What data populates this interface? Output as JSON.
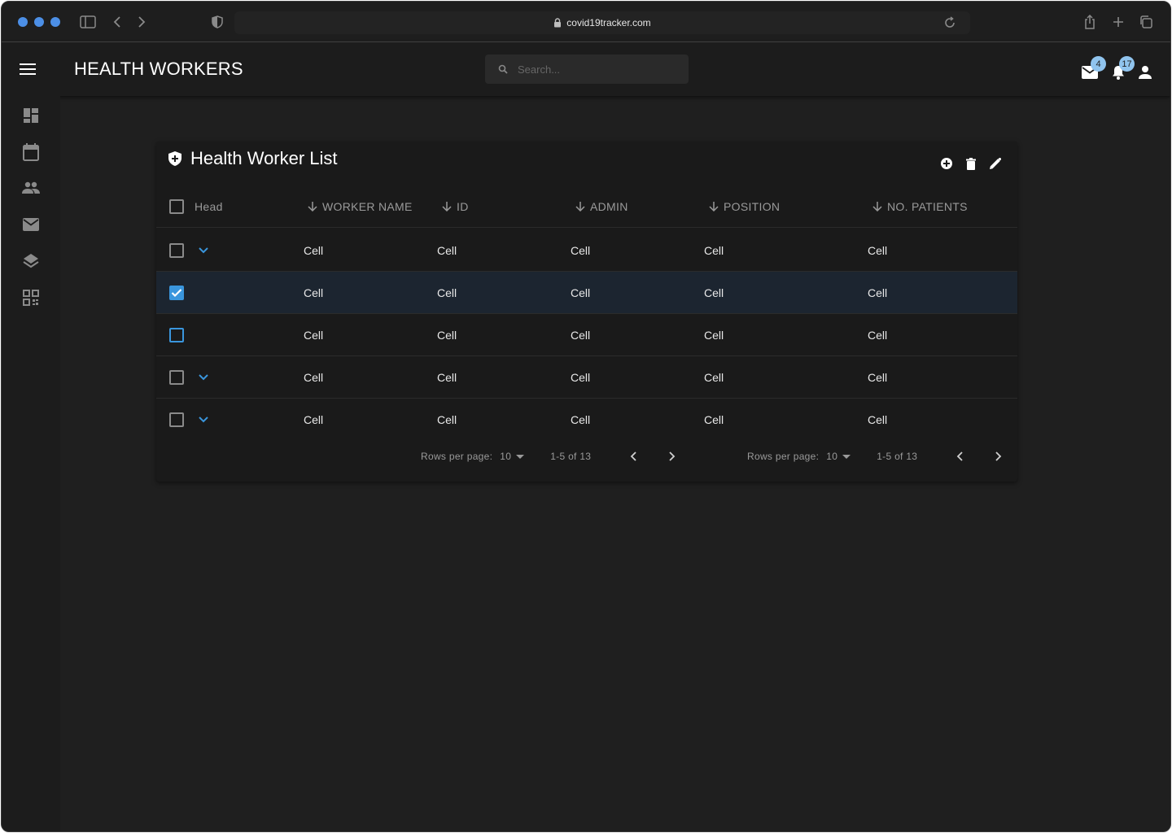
{
  "browser": {
    "url": "covid19tracker.com"
  },
  "appbar": {
    "title": "HEALTH WORKERS",
    "search_placeholder": "Search...",
    "mail_badge": "4",
    "notif_badge": "17"
  },
  "sidenav": {
    "items": [
      "dashboard-icon",
      "calendar-icon",
      "people-icon",
      "mail-icon",
      "layers-icon",
      "qr-icon"
    ]
  },
  "card": {
    "title": "Health Worker List",
    "actions": [
      "add-circle-icon",
      "delete-icon",
      "edit-icon"
    ]
  },
  "table": {
    "headers": {
      "head": "Head",
      "worker_name": "WORKER NAME",
      "id": "ID",
      "admin": "ADMIN",
      "position": "POSITION",
      "patients": "NO. PATIENTS"
    },
    "rows": [
      {
        "checked": false,
        "expandable": true,
        "cells": [
          "Cell",
          "Cell",
          "Cell",
          "Cell",
          "Cell"
        ]
      },
      {
        "checked": true,
        "expandable": false,
        "cells": [
          "Cell",
          "Cell",
          "Cell",
          "Cell",
          "Cell"
        ]
      },
      {
        "checked": false,
        "expandable": false,
        "cells": [
          "Cell",
          "Cell",
          "Cell",
          "Cell",
          "Cell"
        ]
      },
      {
        "checked": false,
        "expandable": true,
        "cells": [
          "Cell",
          "Cell",
          "Cell",
          "Cell",
          "Cell"
        ]
      },
      {
        "checked": false,
        "expandable": true,
        "cells": [
          "Cell",
          "Cell",
          "Cell",
          "Cell",
          "Cell"
        ]
      }
    ]
  },
  "pagination": {
    "rows_label": "Rows per page:",
    "rows_value": "10",
    "range": "1-5 of 13"
  },
  "colors": {
    "accent": "#3a96dd",
    "badge": "#90c4ee",
    "background": "#1f1f1f",
    "card": "#1a1a1a"
  }
}
